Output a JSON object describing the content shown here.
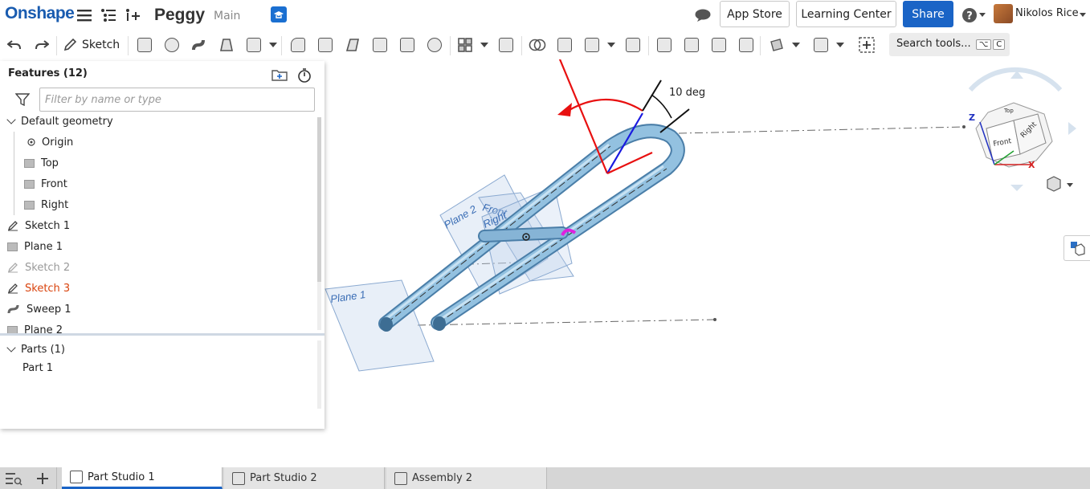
{
  "app": {
    "logo": "Onshape",
    "doc_title": "Peggy",
    "branch": "Main"
  },
  "header": {
    "app_store": "App Store",
    "learning_center": "Learning Center",
    "share": "Share",
    "help_icon": "help-icon",
    "user_name": "Nikolos Rice"
  },
  "toolbar": {
    "sketch_label": "Sketch",
    "search_label": "Search tools...",
    "search_keys": [
      "⌥",
      "C"
    ]
  },
  "features": {
    "title": "Features (12)",
    "filter_placeholder": "Filter by name or type",
    "default_geometry_label": "Default geometry",
    "items": [
      {
        "label": "Origin",
        "icon": "origin-icon",
        "state": "normal"
      },
      {
        "label": "Top",
        "icon": "plane-icon",
        "state": "normal"
      },
      {
        "label": "Front",
        "icon": "plane-icon",
        "state": "normal"
      },
      {
        "label": "Right",
        "icon": "plane-icon",
        "state": "normal"
      },
      {
        "label": "Sketch 1",
        "icon": "sketch-icon",
        "state": "normal"
      },
      {
        "label": "Plane 1",
        "icon": "plane-icon",
        "state": "normal"
      },
      {
        "label": "Sketch 2",
        "icon": "sketch-icon",
        "state": "suppressed"
      },
      {
        "label": "Sketch 3",
        "icon": "sketch-icon",
        "state": "error"
      },
      {
        "label": "Sweep 1",
        "icon": "sweep-icon",
        "state": "normal"
      },
      {
        "label": "Plane 2",
        "icon": "plane-icon",
        "state": "normal"
      }
    ],
    "parts_label": "Parts (1)",
    "parts": [
      "Part 1"
    ]
  },
  "viewport": {
    "dimension_label": "10 deg",
    "plane_labels": [
      "Plane 1",
      "Plane 2",
      "Front",
      "Right",
      "Top"
    ],
    "view_cube": {
      "z": "Z",
      "x": "X",
      "top": "Top",
      "front": "Front",
      "right": "Right"
    },
    "colors": {
      "tube": "#7fb3d8",
      "dimension_arrow": "#e81010",
      "sketch_blue": "#1a1ae0",
      "highlight": "#e020e0"
    }
  },
  "tabs": [
    {
      "label": "Part Studio 1",
      "active": true
    },
    {
      "label": "Part Studio 2",
      "active": false
    },
    {
      "label": "Assembly 2",
      "active": false
    }
  ]
}
